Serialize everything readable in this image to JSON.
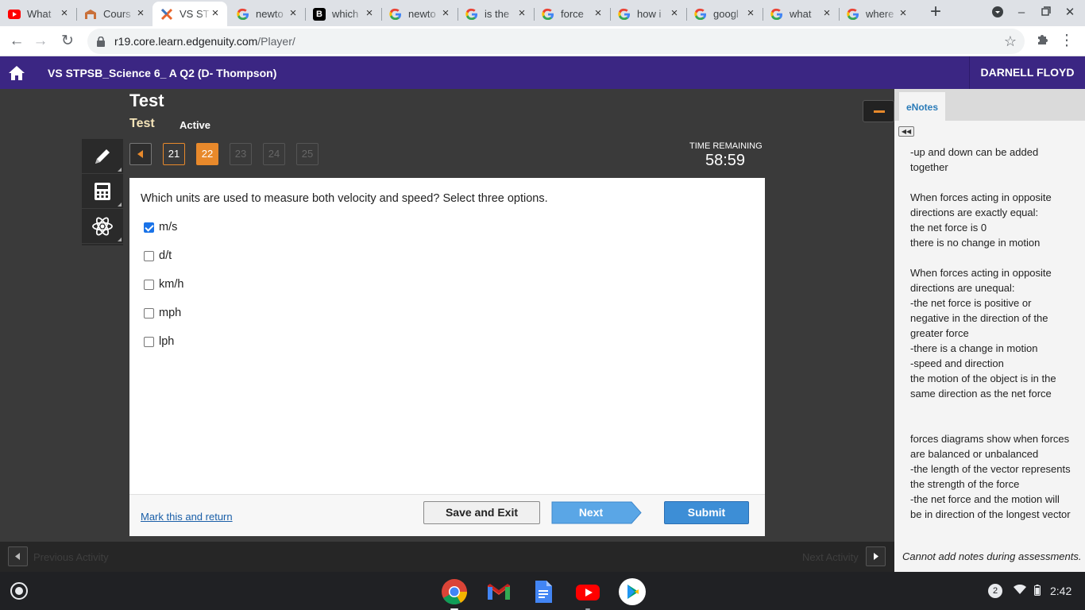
{
  "browser": {
    "tabs": [
      {
        "title": "What",
        "icon": "youtube-icon"
      },
      {
        "title": "Cours",
        "icon": "edgenuity-icon"
      },
      {
        "title": "VS ST",
        "icon": "edgenuity-x-icon",
        "active": true
      },
      {
        "title": "newto",
        "icon": "google-icon"
      },
      {
        "title": "which",
        "icon": "brainly-icon"
      },
      {
        "title": "newto",
        "icon": "google-icon"
      },
      {
        "title": "is the",
        "icon": "google-icon"
      },
      {
        "title": "force",
        "icon": "google-icon"
      },
      {
        "title": "how i",
        "icon": "google-icon"
      },
      {
        "title": "googl",
        "icon": "google-icon"
      },
      {
        "title": "what",
        "icon": "google-icon"
      },
      {
        "title": "where",
        "icon": "google-icon"
      }
    ],
    "url_host": "r19.core.learn.edgenuity.com",
    "url_path": "/Player/"
  },
  "app": {
    "course_title": "VS STPSB_Science 6_ A Q2 (D- Thompson)",
    "user_name": "DARNELL FLOYD"
  },
  "test": {
    "title": "Test",
    "subtitle": "Test",
    "status": "Active",
    "questions": [
      {
        "label": "21",
        "state": "done"
      },
      {
        "label": "22",
        "state": "current"
      },
      {
        "label": "23",
        "state": "disabled"
      },
      {
        "label": "24",
        "state": "disabled"
      },
      {
        "label": "25",
        "state": "disabled"
      }
    ],
    "timer_label": "TIME REMAINING",
    "timer_value": "58:59",
    "question_text": "Which units are used to measure both velocity and speed? Select three options.",
    "options": [
      {
        "label": "m/s",
        "checked": true
      },
      {
        "label": "d/t",
        "checked": false
      },
      {
        "label": "km/h",
        "checked": false
      },
      {
        "label": "mph",
        "checked": false
      },
      {
        "label": "lph",
        "checked": false
      }
    ],
    "mark_return": "Mark this and return",
    "save_exit": "Save and Exit",
    "next": "Next",
    "submit": "Submit"
  },
  "enotes": {
    "tab_label": "eNotes",
    "lines": [
      "-up and down can be added",
      "together",
      "",
      "When forces acting in opposite",
      "directions are exactly equal:",
      "the net force is 0",
      "there is no change in motion",
      "",
      "When forces acting in opposite",
      "directions are unequal:",
      "-the net force is positive or",
      "negative in the direction of the",
      "greater force",
      "-there is a change in motion",
      "-speed and direction",
      "the motion of the object is in the",
      "same direction as the net force",
      "",
      "",
      "forces diagrams show when forces",
      "are balanced or unbalanced",
      "-the length of the vector represents",
      "the strength of the force",
      "-the net force and the motion will",
      "be in direction of the longest vector"
    ],
    "disabled_msg": "Cannot add notes during assessments."
  },
  "activity_bar": {
    "previous": "Previous Activity",
    "next": "Next Activity"
  },
  "shelf": {
    "apps": [
      "chrome-icon",
      "gmail-icon",
      "docs-icon",
      "youtube-icon",
      "play-store-icon"
    ],
    "notification_count": "2",
    "clock": "2:42"
  }
}
